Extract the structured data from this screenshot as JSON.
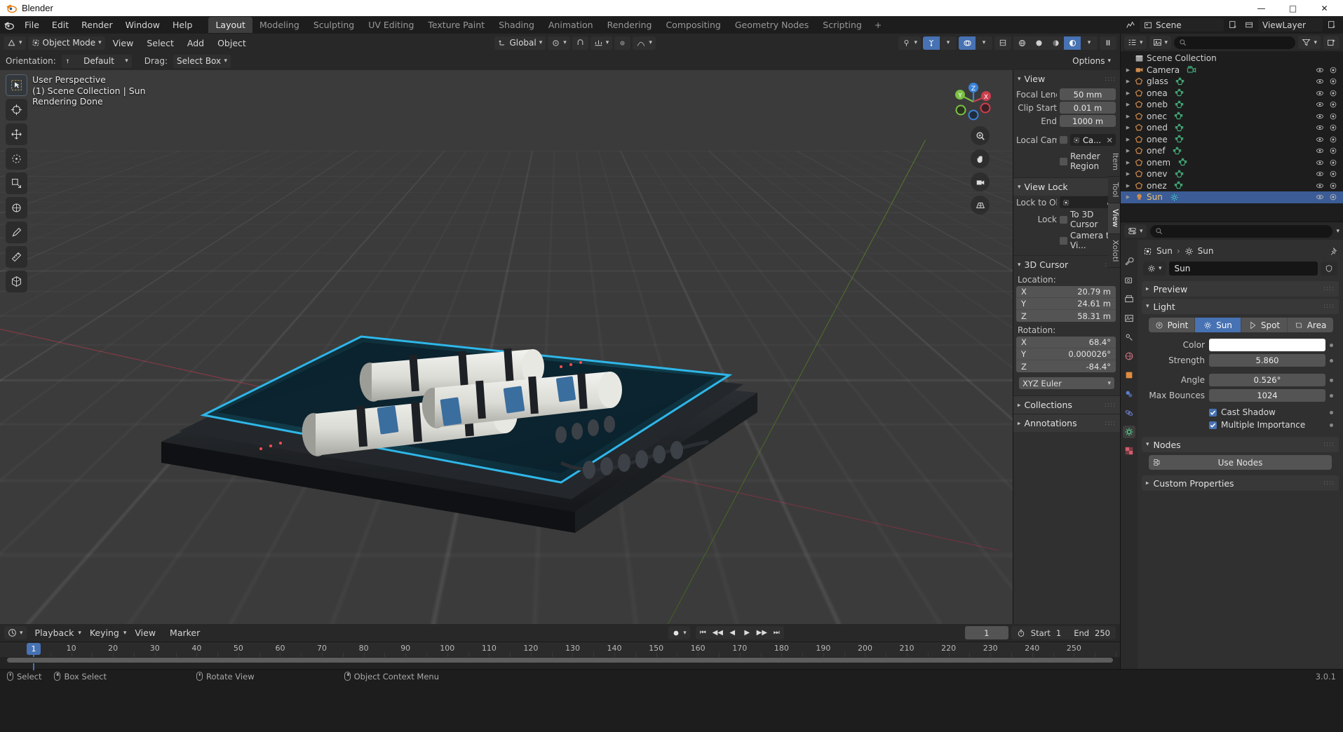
{
  "window": {
    "title": "Blender",
    "controls": [
      "minimize",
      "maximize",
      "close"
    ]
  },
  "topbar": {
    "menus": [
      "File",
      "Edit",
      "Render",
      "Window",
      "Help"
    ],
    "workspaces": [
      "Layout",
      "Modeling",
      "Sculpting",
      "UV Editing",
      "Texture Paint",
      "Shading",
      "Animation",
      "Rendering",
      "Compositing",
      "Geometry Nodes",
      "Scripting"
    ],
    "active_workspace": "Layout",
    "add_workspace": "+",
    "scene_name": "Scene",
    "viewlayer_name": "ViewLayer",
    "scene_icon": "scene-icon",
    "viewlayer_icon": "viewlayer-icon"
  },
  "viewport_header": {
    "mode": "Object Mode",
    "menus": [
      "View",
      "Select",
      "Add",
      "Object"
    ],
    "transform_orientation": "Global",
    "snap_icon": "magnet-icon",
    "proportional_icon": "proportional-edit-icon",
    "editor_type_icon": "editor-type-icon"
  },
  "tool_header": {
    "orientation_label": "Orientation:",
    "orientation_value": "Default",
    "drag_label": "Drag:",
    "drag_value": "Select Box",
    "options_label": "Options"
  },
  "viewport": {
    "overlay_lines": [
      "User Perspective",
      "(1) Scene Collection | Sun",
      "Rendering Done"
    ],
    "toolbar_icons": [
      "select-box-tool",
      "cursor-tool",
      "move-tool",
      "rotate-tool",
      "scale-tool",
      "transform-tool",
      "annotate-tool",
      "measure-tool",
      "add-cube-tool"
    ],
    "nav_icons": [
      "zoom-icon",
      "pan-hand-icon",
      "camera-view-icon",
      "ortho-persp-icon"
    ],
    "gizmo_axes": [
      "X",
      "Y",
      "Z"
    ]
  },
  "npanel": {
    "tabs": [
      "Item",
      "Tool",
      "View",
      "Xolotl"
    ],
    "active_tab": "View",
    "view": {
      "title": "View",
      "focal_length_label": "Focal Lengt",
      "focal_length_value": "50 mm",
      "clip_start_label": "Clip Start",
      "clip_start_value": "0.01 m",
      "clip_end_label": "End",
      "clip_end_value": "1000 m",
      "local_camera_label": "Local Cam...",
      "local_camera_value": "Ca...",
      "render_region_label": "Render Region"
    },
    "view_lock": {
      "title": "View Lock",
      "lock_to_object_label": "Lock to Ob...",
      "lock_to_object_value": "",
      "lock_label": "Lock",
      "to_3d_cursor_label": "To 3D Cursor",
      "camera_to_view_label": "Camera to Vi..."
    },
    "cursor": {
      "title": "3D Cursor",
      "location_label": "Location:",
      "location": [
        {
          "axis": "X",
          "value": "20.79 m"
        },
        {
          "axis": "Y",
          "value": "24.61 m"
        },
        {
          "axis": "Z",
          "value": "58.31 m"
        }
      ],
      "rotation_label": "Rotation:",
      "rotation": [
        {
          "axis": "X",
          "value": "68.4°"
        },
        {
          "axis": "Y",
          "value": "0.000026°"
        },
        {
          "axis": "Z",
          "value": "-84.4°"
        }
      ],
      "rotation_mode": "XYZ Euler"
    },
    "collections_title": "Collections",
    "annotations_title": "Annotations"
  },
  "outliner": {
    "display_mode_icon": "outliner-display-icon",
    "filter_icon": "filter-icon",
    "new_collection_icon": "new-collection-icon",
    "search_placeholder": "",
    "root": "Scene Collection",
    "items": [
      {
        "name": "Camera",
        "type": "camera",
        "data_icon": "camera-data-icon",
        "selected": false
      },
      {
        "name": "glass",
        "type": "mesh",
        "data_icon": "mesh-data-icon",
        "selected": false
      },
      {
        "name": "onea",
        "type": "mesh",
        "data_icon": "mesh-data-icon",
        "selected": false
      },
      {
        "name": "oneb",
        "type": "mesh",
        "data_icon": "mesh-data-icon",
        "selected": false
      },
      {
        "name": "onec",
        "type": "mesh",
        "data_icon": "mesh-data-icon",
        "selected": false
      },
      {
        "name": "oned",
        "type": "mesh",
        "data_icon": "mesh-data-icon",
        "selected": false
      },
      {
        "name": "onee",
        "type": "mesh",
        "data_icon": "mesh-data-icon",
        "selected": false
      },
      {
        "name": "onef",
        "type": "mesh",
        "data_icon": "mesh-data-icon",
        "selected": false
      },
      {
        "name": "onem",
        "type": "mesh",
        "data_icon": "mesh-data-icon",
        "selected": false
      },
      {
        "name": "onev",
        "type": "mesh",
        "data_icon": "mesh-data-icon",
        "selected": false
      },
      {
        "name": "onez",
        "type": "mesh",
        "data_icon": "mesh-data-icon",
        "selected": false
      },
      {
        "name": "Sun",
        "type": "light",
        "data_icon": "sun-data-icon",
        "selected": true
      }
    ]
  },
  "properties": {
    "breadcrumb": [
      "Sun",
      "Sun"
    ],
    "id_name": "Sun",
    "tabs": [
      "tool-tab",
      "render-tab",
      "output-tab",
      "viewlayer-tab",
      "scene-tab",
      "world-tab",
      "object-tab",
      "modifiers-tab",
      "physics-tab",
      "constraints-tab",
      "data-tab",
      "material-tab"
    ],
    "active_tab": "data-tab",
    "preview_title": "Preview",
    "light": {
      "title": "Light",
      "types": [
        "Point",
        "Sun",
        "Spot",
        "Area"
      ],
      "active_type": "Sun",
      "color_label": "Color",
      "color_value": "#ffffff",
      "strength_label": "Strength",
      "strength_value": "5.860",
      "angle_label": "Angle",
      "angle_value": "0.526°",
      "max_bounces_label": "Max Bounces",
      "max_bounces_value": "1024",
      "cast_shadow_label": "Cast Shadow",
      "cast_shadow_checked": true,
      "multiple_importance_label": "Multiple Importance",
      "multiple_importance_checked": true
    },
    "nodes": {
      "title": "Nodes",
      "use_nodes_label": "Use Nodes"
    },
    "custom_properties_title": "Custom Properties"
  },
  "timeline": {
    "editor_icon": "timeline-editor-icon",
    "menus": [
      "Playback",
      "Keying",
      "View",
      "Marker"
    ],
    "auto_key_icon": "record-icon",
    "transport": [
      "jump-start",
      "prev-keyframe",
      "play-reverse",
      "play",
      "next-keyframe",
      "jump-end"
    ],
    "current_frame": "1",
    "use_preview_range_icon": "stopwatch-icon",
    "start_label": "Start",
    "start_value": "1",
    "end_label": "End",
    "end_value": "250",
    "ticks": [
      "1",
      "10",
      "20",
      "30",
      "40",
      "50",
      "60",
      "70",
      "80",
      "90",
      "100",
      "110",
      "120",
      "130",
      "140",
      "150",
      "160",
      "170",
      "180",
      "190",
      "200",
      "210",
      "220",
      "230",
      "240",
      "250"
    ],
    "playhead_frame": "1"
  },
  "statusbar": {
    "items": [
      {
        "icon": "mouse-left-icon",
        "label": "Select"
      },
      {
        "icon": "mouse-left-drag-icon",
        "label": "Box Select"
      },
      {
        "icon": "mouse-middle-icon",
        "label": "Rotate View"
      },
      {
        "icon": "mouse-right-icon",
        "label": "Object Context Menu"
      }
    ],
    "version": "3.0.1"
  },
  "colors": {
    "accent_blue": "#4772b3",
    "selection_blue": "#3b5c96",
    "header_bg": "#282828",
    "panel_bg": "#303030",
    "field_bg": "#545454",
    "viewport_bg": "#3b3b3b",
    "mesh_orange": "#d08b4d",
    "mesh_data_green": "#45b07c",
    "light_teal": "#41c5c5"
  }
}
